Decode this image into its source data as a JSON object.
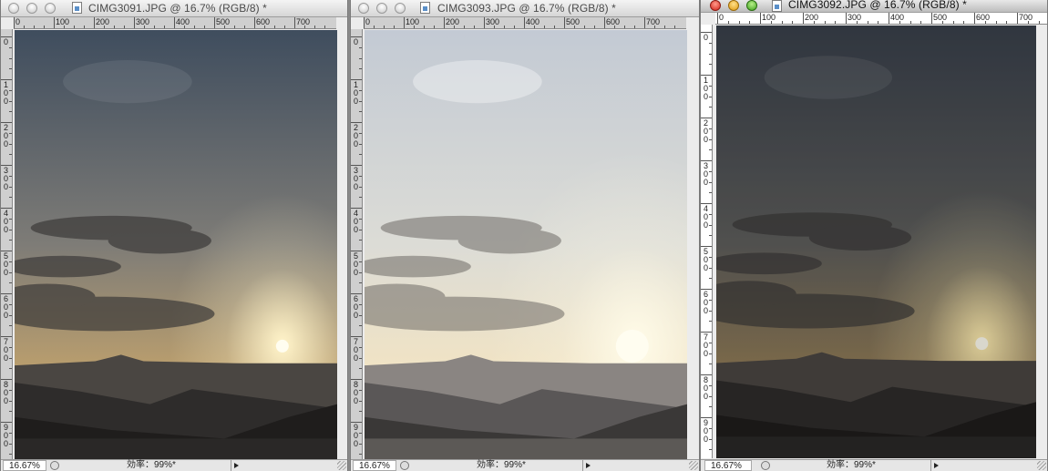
{
  "windows": [
    {
      "title": "CIMG3091.JPG @ 16.7% (RGB/8) *",
      "zoom": "16.67%",
      "status": "効率：99%*",
      "active": false,
      "ruler_h_labels": [
        "0",
        "100",
        "200",
        "300",
        "400",
        "500",
        "600",
        "700"
      ],
      "ruler_v_labels": [
        "0",
        "100",
        "200",
        "300",
        "400",
        "500",
        "600",
        "700",
        "800",
        "900"
      ],
      "sky_top": "#3f4d5e",
      "sky_mid": "#7e7c77",
      "sky_low": "#b89d6e",
      "sun_glow": "#fff3c9"
    },
    {
      "title": "CIMG3093.JPG @ 16.7% (RGB/8) *",
      "zoom": "16.67%",
      "status": "効率：99%*",
      "active": false,
      "ruler_h_labels": [
        "0",
        "100",
        "200",
        "300",
        "400",
        "500",
        "600",
        "700"
      ],
      "ruler_v_labels": [
        "0",
        "100",
        "200",
        "300",
        "400",
        "500",
        "600",
        "700",
        "800",
        "900"
      ],
      "sky_top": "#c3cad4",
      "sky_mid": "#dcdcd6",
      "sky_low": "#f0e3c5",
      "sun_glow": "#fffbe8"
    },
    {
      "title": "CIMG3092.JPG @ 16.7% (RGB/8) *",
      "zoom": "16.67%",
      "status": "効率：99%*",
      "active": true,
      "ruler_h_labels": [
        "0",
        "100",
        "200",
        "300",
        "400",
        "500",
        "600",
        "700"
      ],
      "ruler_v_labels": [
        "0",
        "100",
        "200",
        "300",
        "400",
        "500",
        "600",
        "700",
        "800",
        "900"
      ],
      "sky_top": "#39404b",
      "sky_mid": "#5e5e5c",
      "sky_low": "#8e7a58",
      "sun_glow": "#ffedb0"
    }
  ]
}
